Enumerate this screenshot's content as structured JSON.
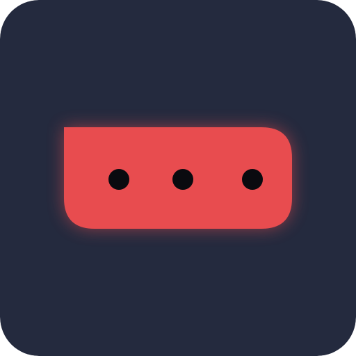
{
  "icon": {
    "name": "chat-bubble-ellipsis-icon",
    "background_color": "#242a3e",
    "bubble_color": "#e84c4f",
    "glow_color": "#e84c4f",
    "dot_color": "#0a0a0f",
    "dot_count": 3
  }
}
